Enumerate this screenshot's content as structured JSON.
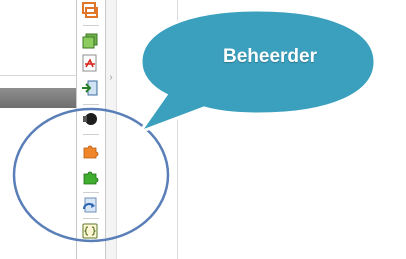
{
  "callout": {
    "label": "Beheerder",
    "fill": "#3aa0bd",
    "stroke": "#ffffff"
  },
  "highlight": {
    "stroke": "#5a7fb8"
  },
  "toolbar": {
    "buttons": [
      {
        "icon": "crop-icon"
      },
      {
        "icon": "layers-icon"
      },
      {
        "icon": "pdf-icon"
      },
      {
        "icon": "import-icon"
      },
      {
        "icon": "dark-record-icon"
      },
      {
        "icon": "orange-puzzle-icon"
      },
      {
        "icon": "green-puzzle-icon"
      },
      {
        "icon": "refresh-document-icon"
      },
      {
        "icon": "code-block-icon"
      }
    ]
  }
}
